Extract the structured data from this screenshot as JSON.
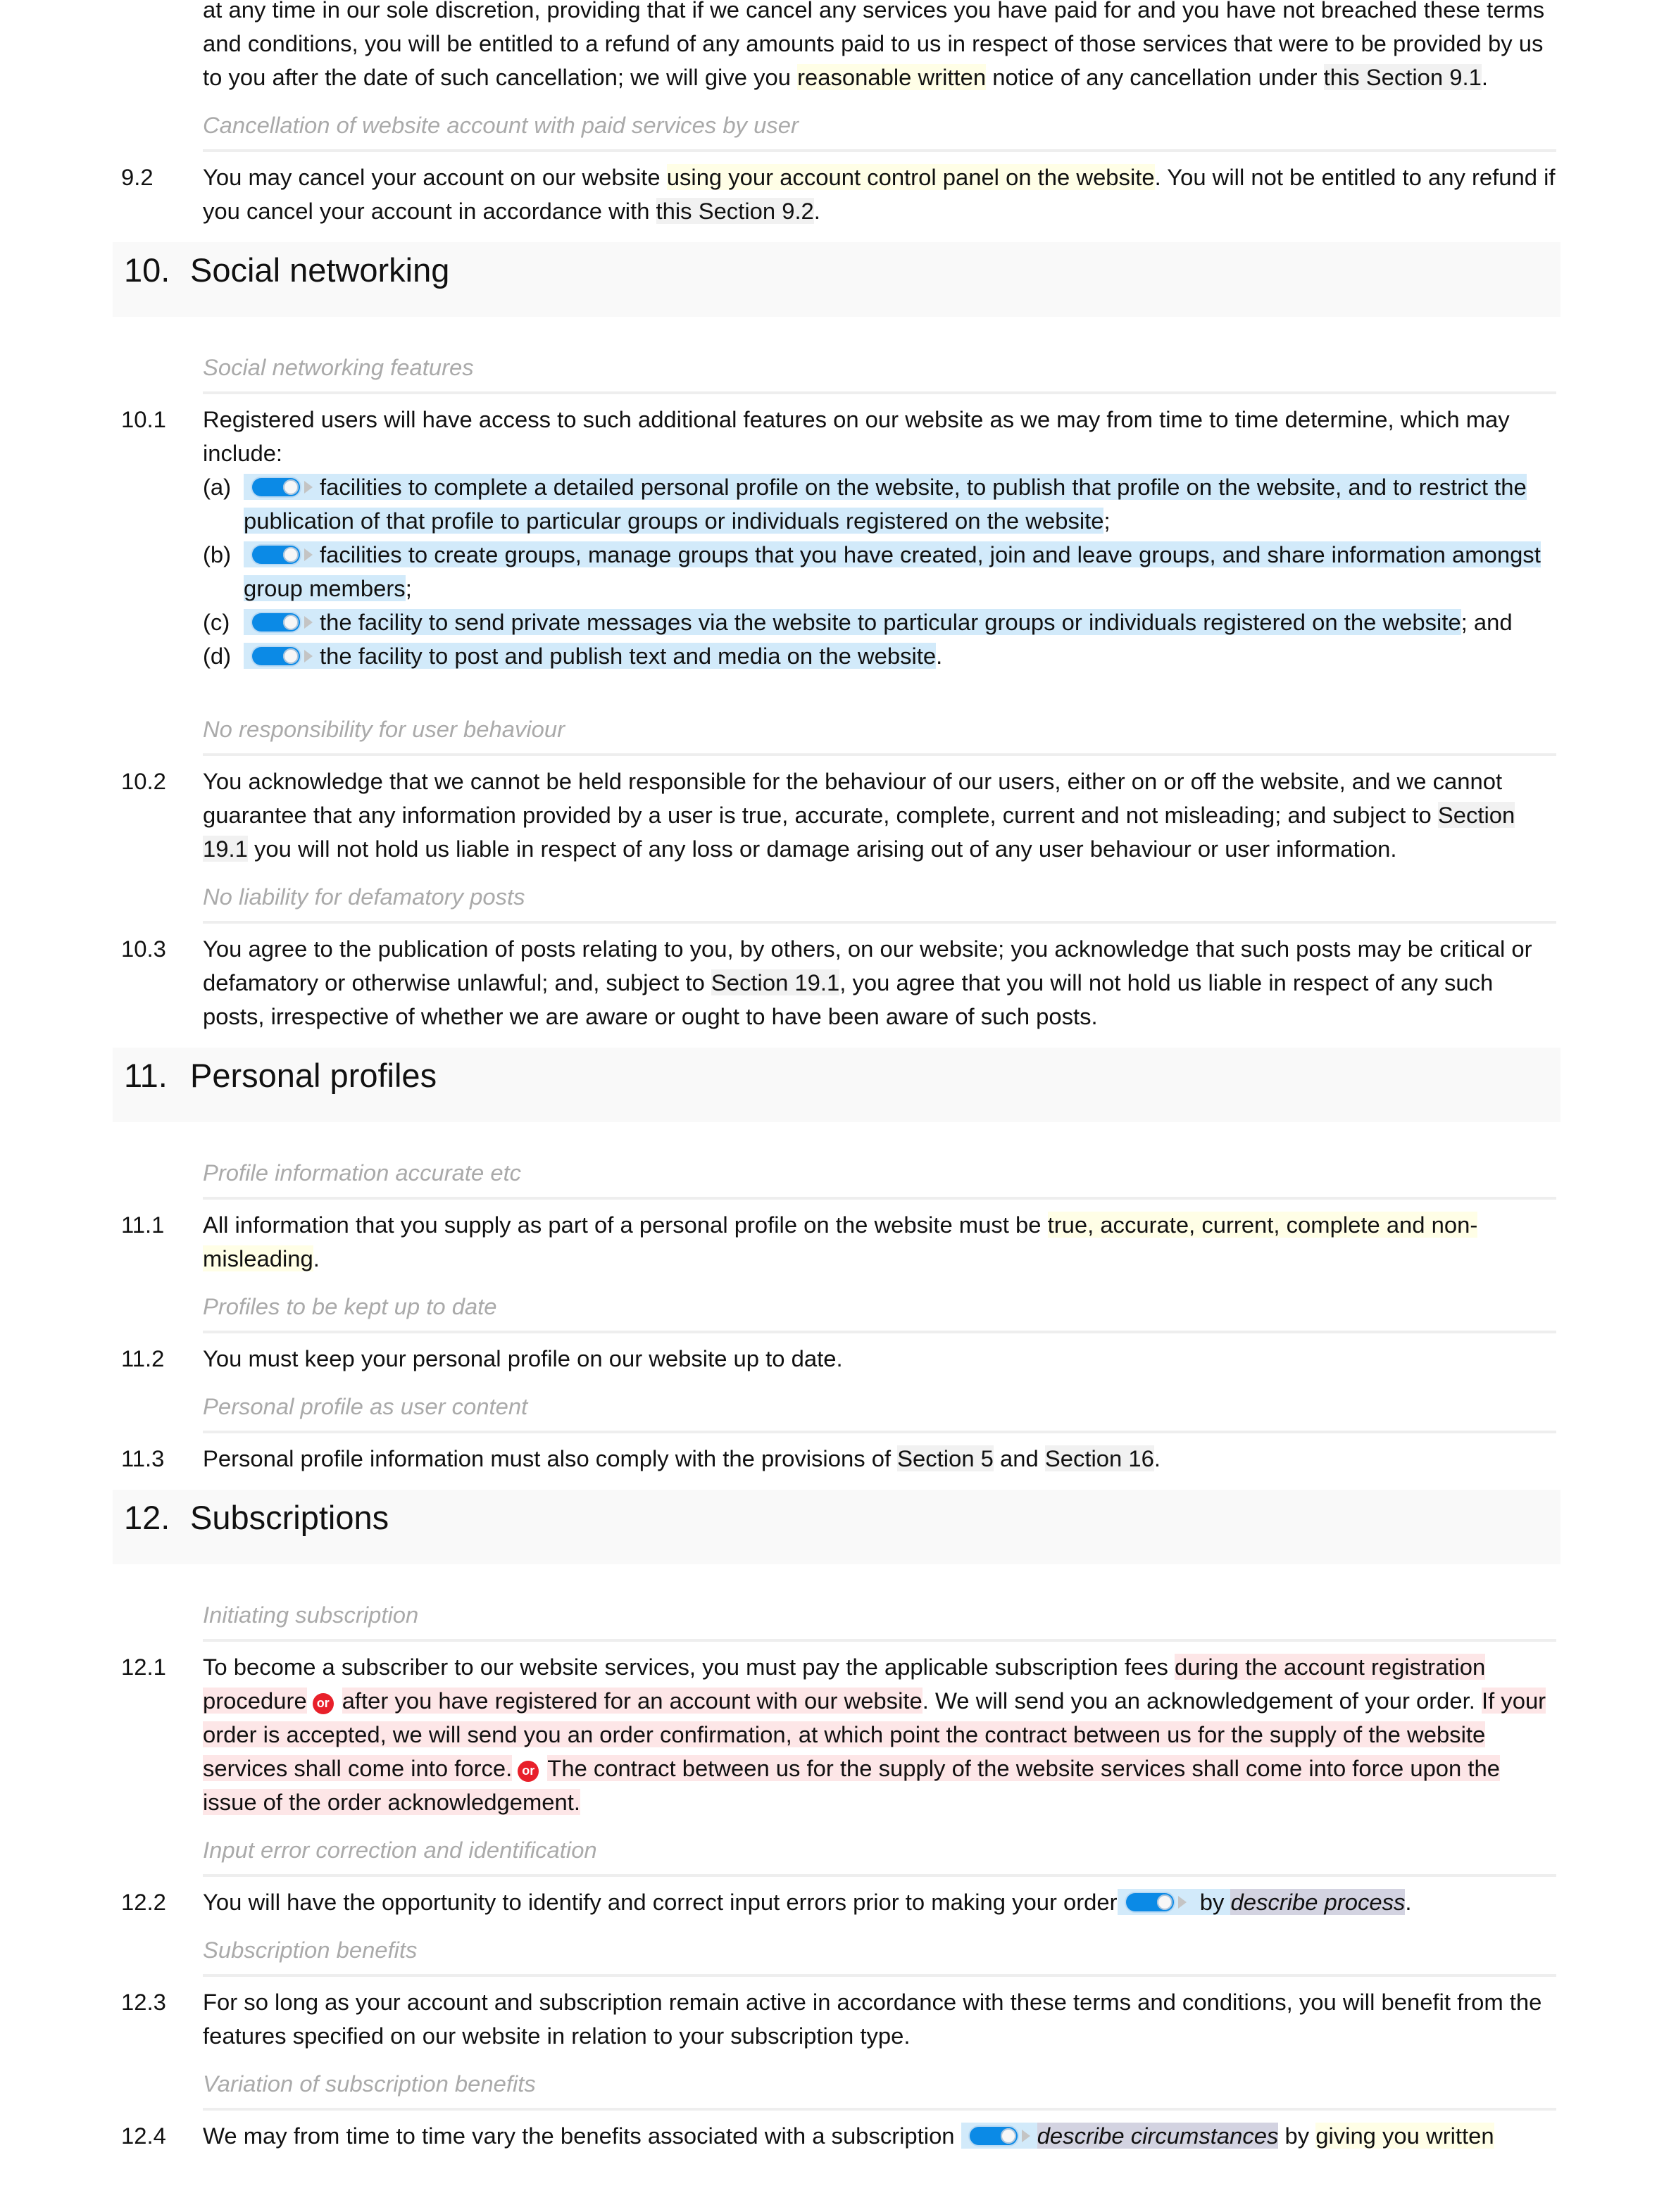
{
  "section9": {
    "clause_9_1_tail": {
      "text_a": "at any time in our sole discretion, providing that if we cancel any services you have paid for and you have not breached these terms and conditions, you will be entitled to a refund of any amounts paid to us in respect of those services that were to be provided by us to you after the date of such cancellation; we will give you ",
      "option": "reasonable written",
      "text_b": " notice of any cancellation under ",
      "ref": "this Section 9.1",
      "text_c": "."
    },
    "clause_9_2": {
      "subtitle": "Cancellation of website account with paid services by user",
      "number": "9.2",
      "text_a": "You may cancel your account on our website ",
      "option": "using your account control panel on the website",
      "text_b": ". You will not be entitled to any refund if you cancel your account in accordance with ",
      "ref": "this Section 9.2",
      "text_c": "."
    }
  },
  "section10": {
    "number": "10.",
    "title": "Social networking",
    "clause_10_1": {
      "subtitle": "Social networking features",
      "number": "10.1",
      "text": "Registered users will have access to such additional features on our website as we may from time to time determine, which may include:",
      "items": [
        {
          "letter": "(a)",
          "text": "facilities to complete a detailed personal profile on the website, to publish that profile on the website, and to restrict the publication of that profile to particular groups or individuals registered on the website",
          "suffix": ";",
          "toggle_on": true
        },
        {
          "letter": "(b)",
          "text": "facilities to create groups, manage groups that you have created, join and leave groups, and share information amongst group members",
          "suffix": ";",
          "toggle_on": true
        },
        {
          "letter": "(c)",
          "text": "the facility to send private messages via the website to particular groups or individuals registered on the website",
          "suffix": "; and",
          "toggle_on": true
        },
        {
          "letter": "(d)",
          "text": "the facility to post and publish text and media on the website",
          "suffix": ".",
          "toggle_on": true
        }
      ]
    },
    "clause_10_2": {
      "subtitle": "No responsibility for user behaviour",
      "number": "10.2",
      "text_a": "You acknowledge that we cannot be held responsible for the behaviour of our users, either on or off the website, and we cannot guarantee that any information provided by a user is true, accurate, complete, current and not misleading; and subject to ",
      "ref": "Section 19.1",
      "text_b": " you will not hold us liable in respect of any loss or damage arising out of any user behaviour or user information."
    },
    "clause_10_3": {
      "subtitle": "No liability for defamatory posts",
      "number": "10.3",
      "text_a": "You agree to the publication of posts relating to you, by others, on our website; you acknowledge that such posts may be critical or defamatory or otherwise unlawful; and, subject to ",
      "ref": "Section 19.1",
      "text_b": ", you agree that you will not hold us liable in respect of any such posts, irrespective of whether we are aware or ought to have been aware of such posts."
    }
  },
  "section11": {
    "number": "11.",
    "title": "Personal profiles",
    "clause_11_1": {
      "subtitle": "Profile information accurate etc",
      "number": "11.1",
      "text_a": "All information that you supply as part of a personal profile on the website must be ",
      "option": "true, accurate, current, complete and non-misleading",
      "text_b": "."
    },
    "clause_11_2": {
      "subtitle": "Profiles to be kept up to date",
      "number": "11.2",
      "text": "You must keep your personal profile on our website up to date."
    },
    "clause_11_3": {
      "subtitle": "Personal profile as user content",
      "number": "11.3",
      "text_a": "Personal profile information must also comply with the provisions of ",
      "ref_1": "Section 5",
      "text_b": " and ",
      "ref_2": "Section 16",
      "text_c": "."
    }
  },
  "section12": {
    "number": "12.",
    "title": "Subscriptions",
    "clause_12_1": {
      "subtitle": "Initiating subscription",
      "number": "12.1",
      "text_a": "To become a subscriber to our website services, you must pay the applicable subscription fees ",
      "alt_1a": "during the account registration procedure",
      "or_label": "or",
      "alt_1b": "after you have registered for an account with our website",
      "text_b": ". We will send you an acknowledgement of your order. ",
      "alt_2a": "If your order is accepted, we will send you an order confirmation, at which point the contract between us for the supply of the website services shall come into force.",
      "alt_2b": "The contract between us for the supply of the website services shall come into force upon the issue of the order acknowledgement."
    },
    "clause_12_2": {
      "subtitle": "Input error correction and identification",
      "number": "12.2",
      "text_a": "You will have the opportunity to identify and correct input errors prior to making your order",
      "toggle_text": " by ",
      "variable": "describe process",
      "text_b": "."
    },
    "clause_12_3": {
      "subtitle": "Subscription benefits",
      "number": "12.3",
      "text": "For so long as your account and subscription remain active in accordance with these terms and conditions, you will benefit from the features specified on our website in relation to your subscription type."
    },
    "clause_12_4": {
      "subtitle": "Variation of subscription benefits",
      "number": "12.4",
      "text_a": "We may from time to time vary the benefits associated with a subscription",
      "variable": "describe circumstances",
      "text_b": " by ",
      "option": "giving you written"
    }
  },
  "colors": {
    "option_highlight": "#fffee6",
    "toggle_highlight": "#d2eafa",
    "alternative_highlight": "#fde6e7",
    "variable_highlight": "#d3d3e1",
    "reference_highlight": "#f1f1f1",
    "toggle_track": "#0b8ae6",
    "or_badge": "#e8202a",
    "subtitle_text": "#aaaaaa",
    "heading_band": "#f9f9f9"
  }
}
